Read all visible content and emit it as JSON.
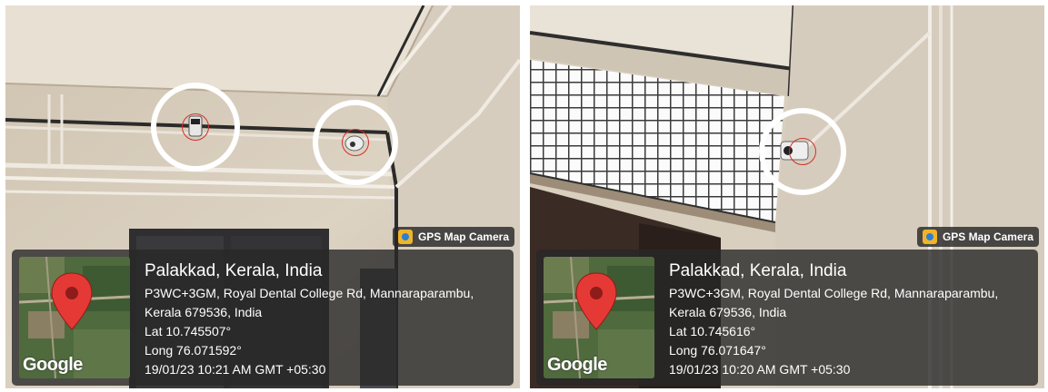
{
  "photos": [
    {
      "badge": {
        "icon": "gps-map-camera-icon",
        "label": "GPS Map Camera"
      },
      "map": {
        "icon": "map-pin-icon",
        "watermark": "Google"
      },
      "place": "Palakkad, Kerala, India",
      "address_line1": "P3WC+3GM, Royal Dental College Rd, Mannaraparambu,",
      "address_line2": "Kerala 679536, India",
      "lat": "Lat 10.745507°",
      "long": "Long 76.071592°",
      "timestamp": "19/01/23 10:21 AM GMT +05:30"
    },
    {
      "badge": {
        "icon": "gps-map-camera-icon",
        "label": "GPS Map Camera"
      },
      "map": {
        "icon": "map-pin-icon",
        "watermark": "Google"
      },
      "place": "Palakkad, Kerala, India",
      "address_line1": "P3WC+3GM, Royal Dental College Rd, Mannaraparambu,",
      "address_line2": "Kerala 679536, India",
      "lat": "Lat 10.745616°",
      "long": "Long 76.071647°",
      "timestamp": "19/01/23 10:20 AM GMT +05:30"
    }
  ],
  "colors": {
    "wall": "#ddd2c1",
    "ceiling": "#e6ddd0",
    "marker": "#ffffff",
    "overlay": "#282828",
    "pin": "#e53935"
  }
}
